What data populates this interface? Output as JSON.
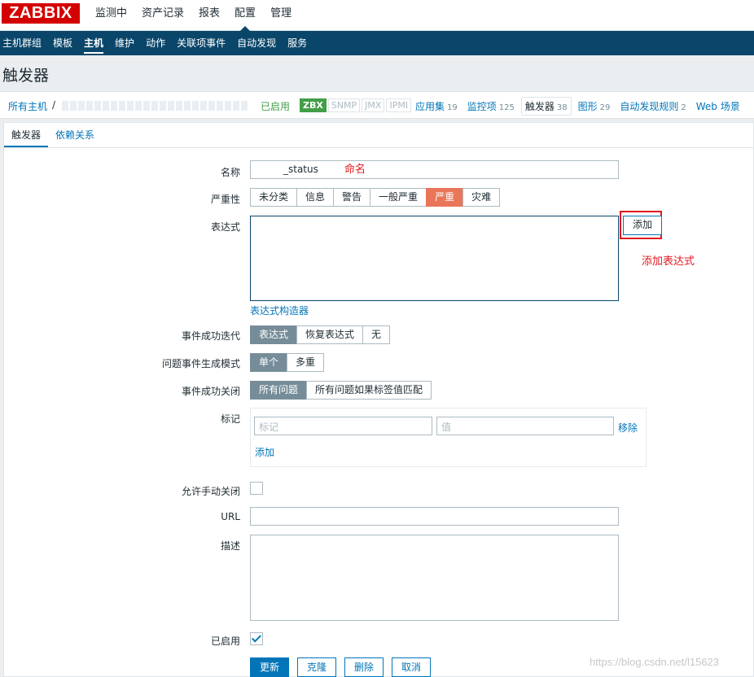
{
  "logo": "ZABBIX",
  "top_nav": [
    "监测中",
    "资产记录",
    "报表",
    "配置",
    "管理"
  ],
  "sub_nav": [
    "主机群组",
    "模板",
    "主机",
    "维护",
    "动作",
    "关联项事件",
    "自动发现",
    "服务"
  ],
  "page_title": "触发器",
  "host_bar": {
    "all_hosts": "所有主机",
    "separator": "/",
    "enabled": "已启用",
    "badges": [
      "ZBX",
      "SNMP",
      "JMX",
      "IPMI"
    ],
    "links": [
      {
        "label": "应用集",
        "count": "19"
      },
      {
        "label": "监控项",
        "count": "125"
      },
      {
        "label": "触发器",
        "count": "38"
      },
      {
        "label": "图形",
        "count": "29"
      },
      {
        "label": "自动发现规则",
        "count": "2"
      },
      {
        "label": "Web 场景",
        "count": ""
      }
    ]
  },
  "tabs": [
    "触发器",
    "依赖关系"
  ],
  "form": {
    "name_label": "名称",
    "name_value": "_status",
    "severity_label": "严重性",
    "severity_options": [
      "未分类",
      "信息",
      "警告",
      "一般严重",
      "严重",
      "灾难"
    ],
    "expression_label": "表达式",
    "add_button": "添加",
    "expression_builder_link": "表达式构造器",
    "ok_event_label": "事件成功迭代",
    "ok_event_options": [
      "表达式",
      "恢复表达式",
      "无"
    ],
    "problem_mode_label": "问题事件生成模式",
    "problem_mode_options": [
      "单个",
      "多重"
    ],
    "ok_close_label": "事件成功关闭",
    "ok_close_options": [
      "所有问题",
      "所有问题如果标签值匹配"
    ],
    "tags_label": "标记",
    "tag_placeholder": "标记",
    "value_placeholder": "值",
    "remove_link": "移除",
    "add_link": "添加",
    "manual_close_label": "允许手动关闭",
    "url_label": "URL",
    "description_label": "描述",
    "enabled_label": "已启用",
    "buttons": [
      "更新",
      "克隆",
      "删除",
      "取消"
    ]
  },
  "annotations": {
    "name_note": "命名",
    "expression_note": "添加表达式"
  },
  "watermark": "https://blog.csdn.net/l15623"
}
